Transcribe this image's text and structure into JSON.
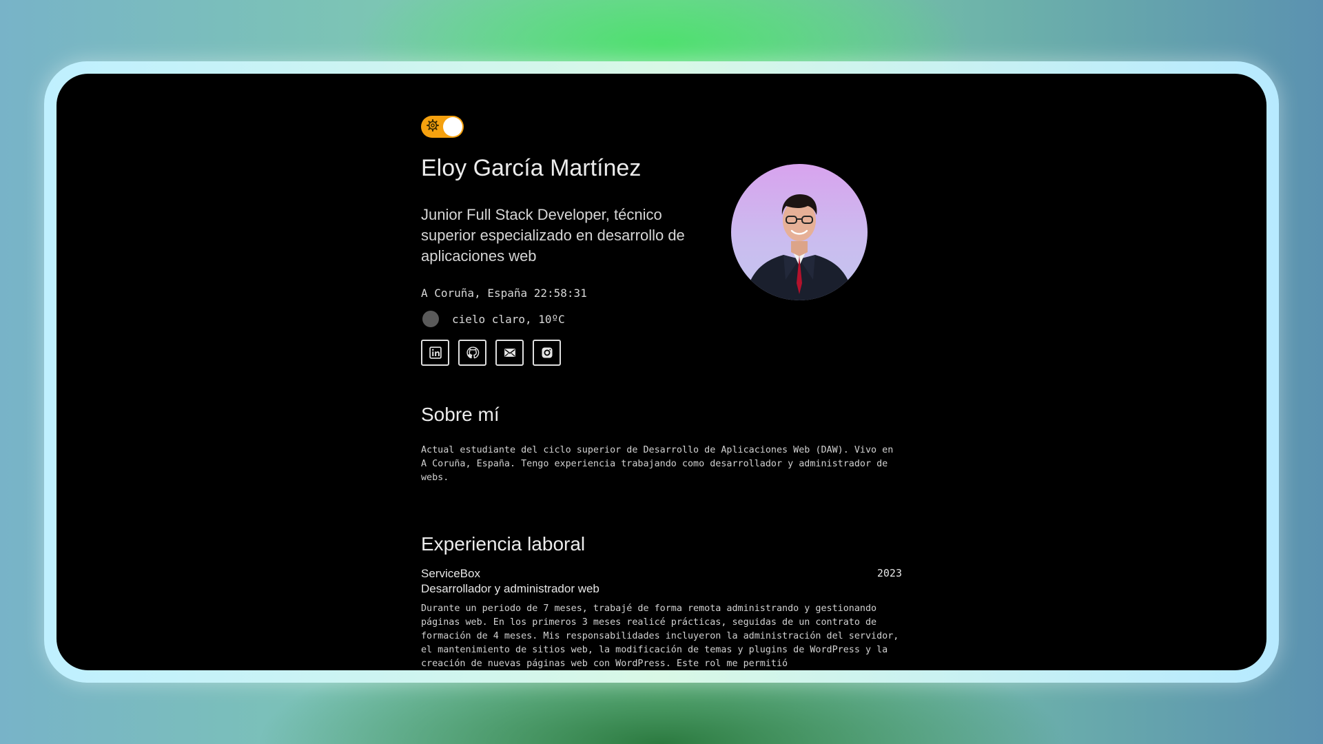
{
  "profile": {
    "name": "Eloy García Martínez",
    "headline": "Junior Full Stack Developer, técnico superior especializado en desarrollo de aplicaciones web",
    "location_time": "A Coruña, España 22:58:31",
    "weather": "cielo claro, 10ºC"
  },
  "theme_toggle": {
    "icon": "gear-icon",
    "accent": "#f5a10f"
  },
  "socials": [
    {
      "icon": "linkedin-icon"
    },
    {
      "icon": "github-icon"
    },
    {
      "icon": "mail-icon"
    },
    {
      "icon": "instagram-icon"
    }
  ],
  "about": {
    "title": "Sobre mí",
    "text": "Actual estudiante del ciclo superior de Desarrollo de Aplicaciones Web (DAW). Vivo en A Coruña, España. Tengo experiencia trabajando como desarrollador y administrador de webs."
  },
  "experience": {
    "title": "Experiencia laboral",
    "items": [
      {
        "company": "ServiceBox",
        "year": "2023",
        "role": "Desarrollador y administrador web",
        "description": "Durante un periodo de 7 meses, trabajé de forma remota administrando y gestionando páginas web. En los primeros 3 meses realicé prácticas, seguidas de un contrato de formación de 4 meses. Mis responsabilidades incluyeron la administración del servidor, el mantenimiento de sitios web, la modificación de temas y plugins de WordPress y la creación de nuevas páginas web con WordPress. Este rol me permitió"
      }
    ]
  }
}
